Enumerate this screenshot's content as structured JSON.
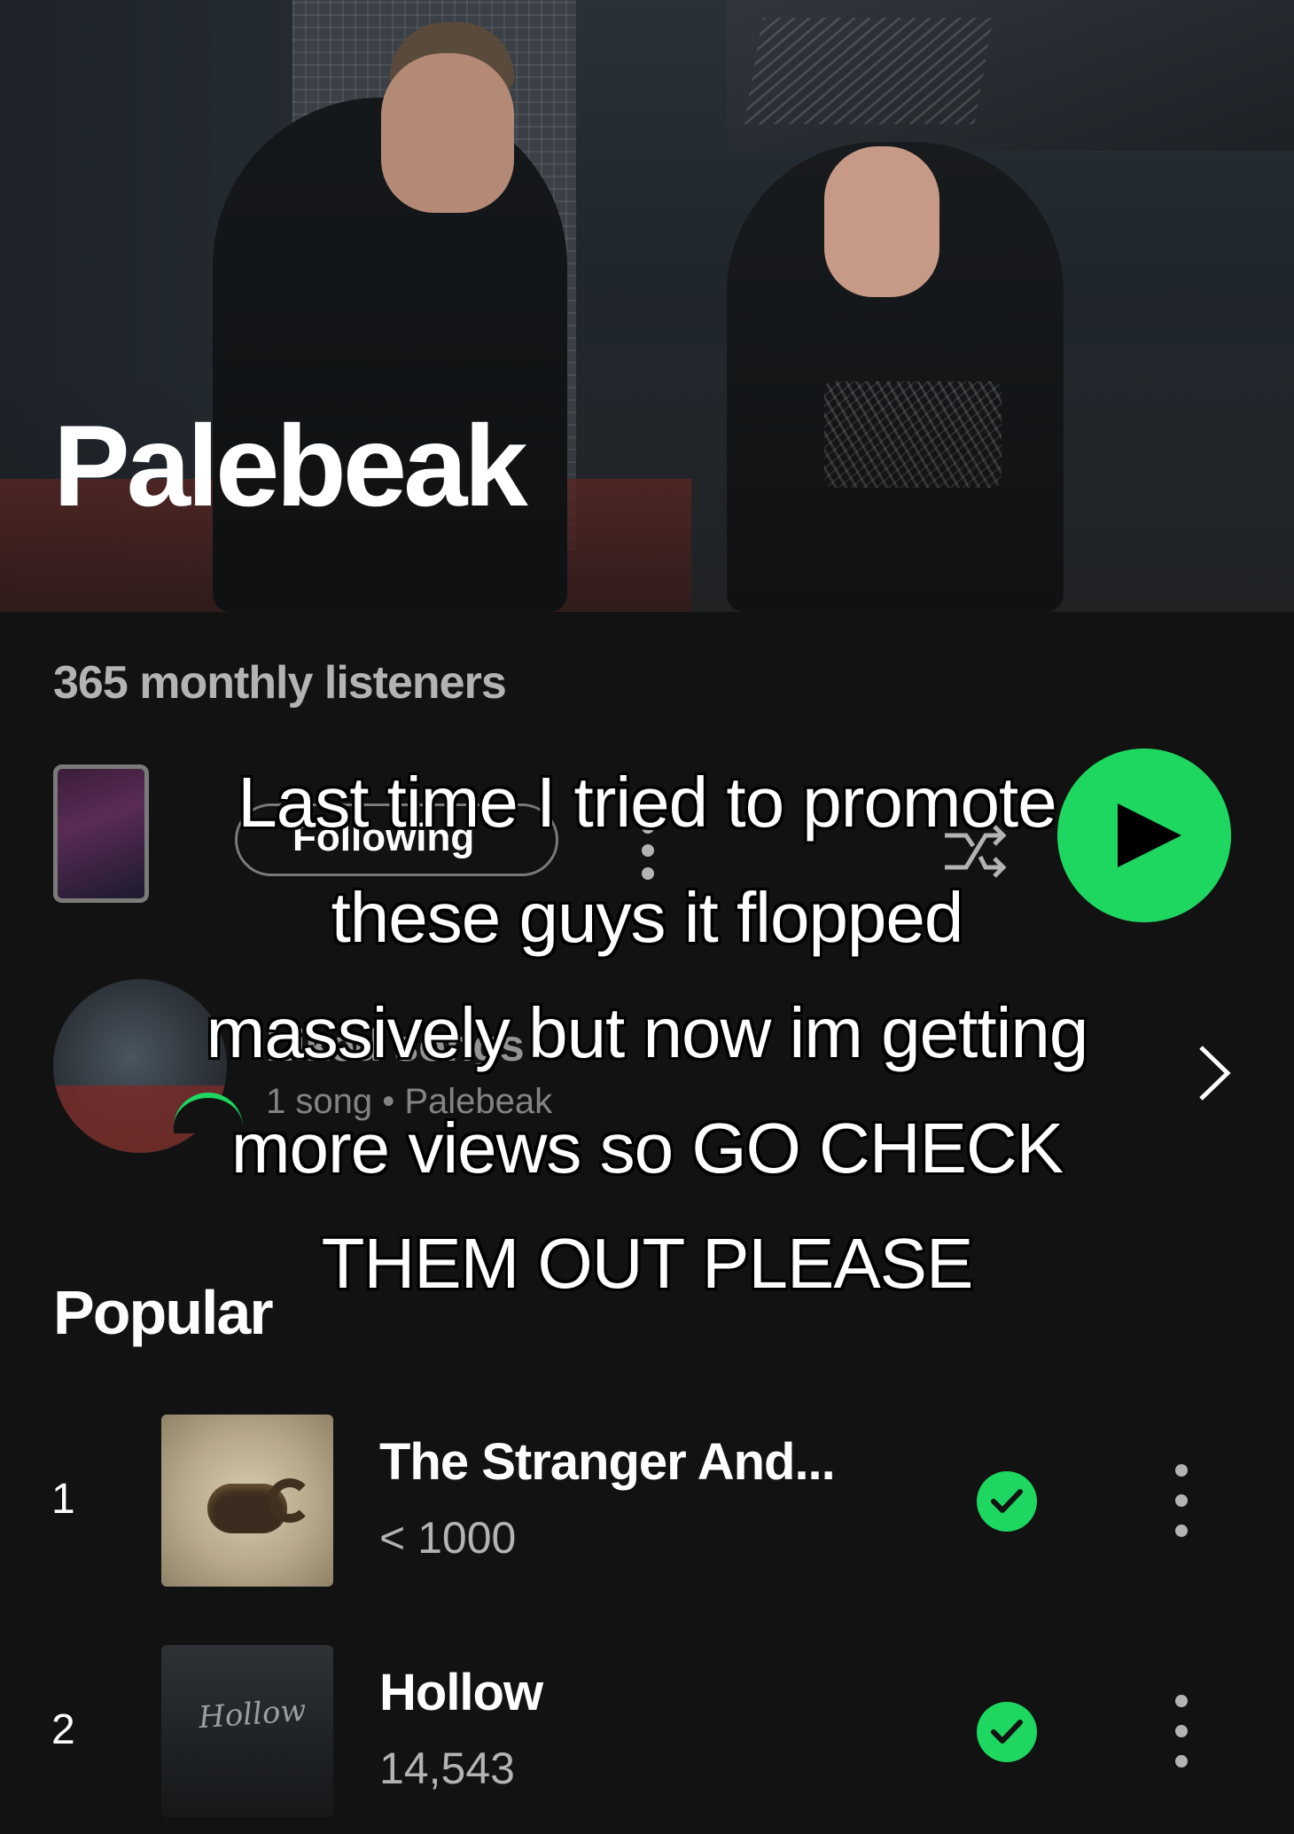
{
  "artist": {
    "name": "Palebeak",
    "monthly_listeners": "365 monthly listeners"
  },
  "actions": {
    "following_label": "Following"
  },
  "release": {
    "title": "Liked songs",
    "subtitle": "1 song • Palebeak"
  },
  "caption": {
    "lines": [
      "Last time I tried to promote",
      "these guys it flopped",
      "massively but now im getting",
      "more views so GO CHECK",
      "THEM OUT PLEASE"
    ]
  },
  "popular": {
    "title": "Popular",
    "tracks": [
      {
        "index": "1",
        "title": "The Stranger And...",
        "plays": "< 1000",
        "art_label": ""
      },
      {
        "index": "2",
        "title": "Hollow",
        "plays": "14,543",
        "art_label": "Hollow"
      }
    ]
  },
  "colors": {
    "accent": "#1ed760",
    "background": "#121212",
    "muted_text": "#b3b3b3"
  },
  "icons": {
    "play": "play-icon",
    "shuffle": "shuffle-icon",
    "more": "more-vertical-icon",
    "saved": "check-circle-icon",
    "chevron": "chevron-right-icon"
  }
}
